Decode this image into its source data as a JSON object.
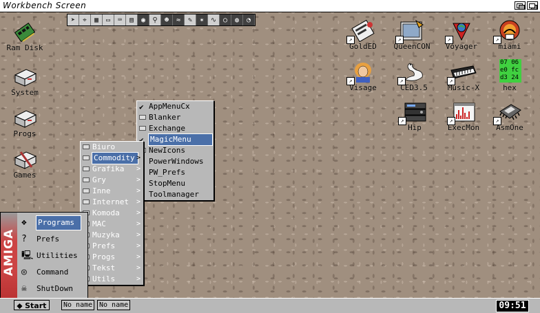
{
  "screen_title": "Workbench Screen",
  "toolbar": {
    "icons": [
      "arrow-icon",
      "tool-icon",
      "calculator-icon",
      "monitor-icon",
      "keyboard-icon",
      "drawer-icon",
      "eye-icon",
      "joystick-icon",
      "people-icon",
      "wave-icon",
      "pen-icon",
      "star-icon",
      "signature-icon",
      "ring-icon",
      "globe-icon",
      "glasses-icon"
    ]
  },
  "desktop_left": [
    {
      "label": "Ram Disk",
      "icon": "ram-disk-icon"
    },
    {
      "label": "System",
      "icon": "drive-icon"
    },
    {
      "label": "Progs",
      "icon": "drive-icon"
    },
    {
      "label": "Games",
      "icon": "drive-icon"
    }
  ],
  "desktop_right": [
    {
      "label": "GoldED",
      "icon": "goldED-icon"
    },
    {
      "label": "QueenCON",
      "icon": "terminal-icon"
    },
    {
      "label": "Voyager",
      "icon": "globe-icon"
    },
    {
      "label": "miami",
      "icon": "miami-icon"
    },
    {
      "label": "Visage",
      "icon": "portrait-icon"
    },
    {
      "label": "CED3.5",
      "icon": "swan-icon"
    },
    {
      "label": "Music-X",
      "icon": "piano-icon"
    },
    {
      "label": "hex",
      "icon": "hex-icon",
      "hex_lines": [
        "07 06",
        "e0 fc",
        "d3 24"
      ]
    },
    {
      "label": "Hip",
      "icon": "stereo-icon"
    },
    {
      "label": "ExecMon",
      "icon": "graph-icon"
    },
    {
      "label": "AsmOne",
      "icon": "chip-icon"
    }
  ],
  "start_menu": {
    "brand": "AMIGA",
    "items": [
      {
        "label": "Programs",
        "icon": "cube-icon"
      },
      {
        "label": "Prefs",
        "icon": "question-icon"
      },
      {
        "label": "Utilities",
        "icon": "computer-icon"
      },
      {
        "label": "Command",
        "icon": "shell-icon"
      },
      {
        "label": "ShutDown",
        "icon": "skull-icon"
      }
    ]
  },
  "programs_menu": {
    "items": [
      "Biuro",
      "Commodity",
      "Grafika",
      "Gry",
      "Inne",
      "Internet",
      "Komoda",
      "MAC",
      "Muzyka",
      "Prefs",
      "Progs",
      "Tekst",
      "Utils"
    ],
    "submenu_marker": ">"
  },
  "commodity_menu": {
    "items": [
      {
        "label": "AppMenuCx",
        "checked": true
      },
      {
        "label": "Blanker",
        "checked": false
      },
      {
        "label": "Exchange",
        "checked": false
      },
      {
        "label": "MagicMenu",
        "checked": true
      },
      {
        "label": "NewIcons",
        "checked": false
      },
      {
        "label": "PowerWindows",
        "checked": true
      },
      {
        "label": "PW_Prefs",
        "checked": true
      },
      {
        "label": "StopMenu",
        "checked": true
      },
      {
        "label": "Toolmanager",
        "checked": true
      }
    ]
  },
  "taskbar": {
    "start_label": "Start",
    "tasks": [
      "No name",
      "No name"
    ],
    "clock": "09:51"
  }
}
